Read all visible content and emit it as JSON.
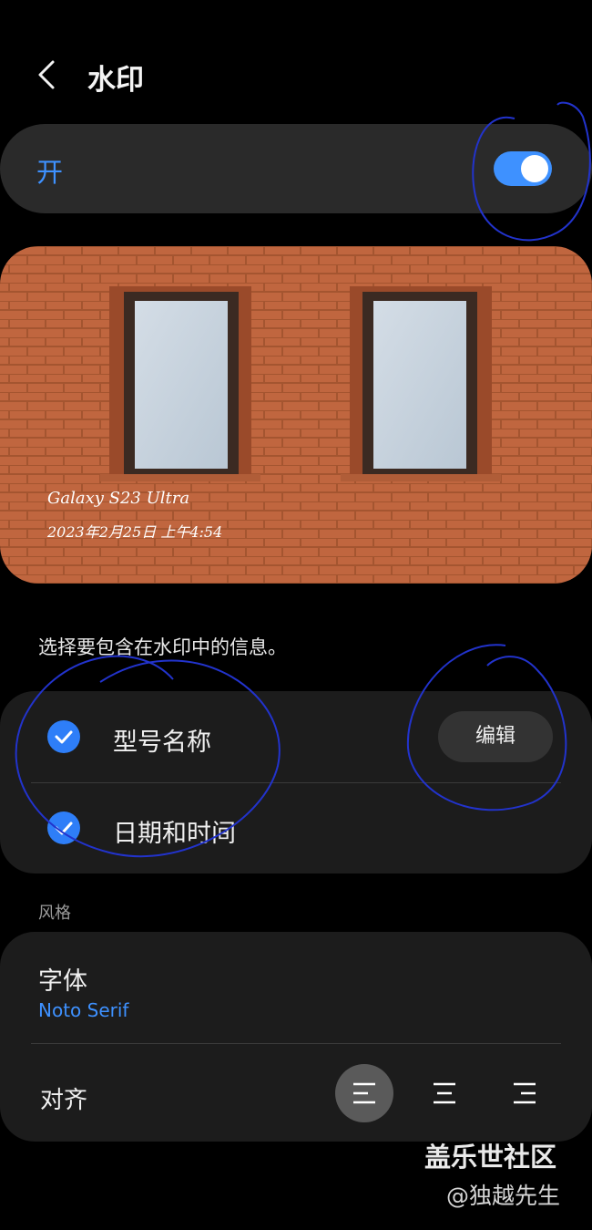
{
  "header": {
    "back_icon": "chevron-left-icon",
    "title": "水印"
  },
  "master_toggle": {
    "label": "开",
    "state": true,
    "accent": "#3e91ff"
  },
  "preview": {
    "watermark_model": "Galaxy S23 Ultra",
    "watermark_datetime": "2023年2月25日 上午4:54"
  },
  "instruction": "选择要包含在水印中的信息。",
  "info_options": [
    {
      "label": "型号名称",
      "checked": true
    },
    {
      "label": "日期和时间",
      "checked": true
    }
  ],
  "edit_button": "编辑",
  "style_section": {
    "header": "风格",
    "font": {
      "title": "字体",
      "value": "Noto Serif"
    },
    "align": {
      "label": "对齐",
      "options": [
        {
          "icon": "align-left-icon",
          "selected": true
        },
        {
          "icon": "align-center-icon",
          "selected": false
        },
        {
          "icon": "align-right-icon",
          "selected": false
        }
      ]
    }
  },
  "overlay_watermark": {
    "site": "盖乐世社区",
    "author": "@独越先生"
  },
  "colors": {
    "background": "#000000",
    "card": "#1c1c1c",
    "accent": "#3e91ff",
    "annotation": "#2233cc"
  }
}
